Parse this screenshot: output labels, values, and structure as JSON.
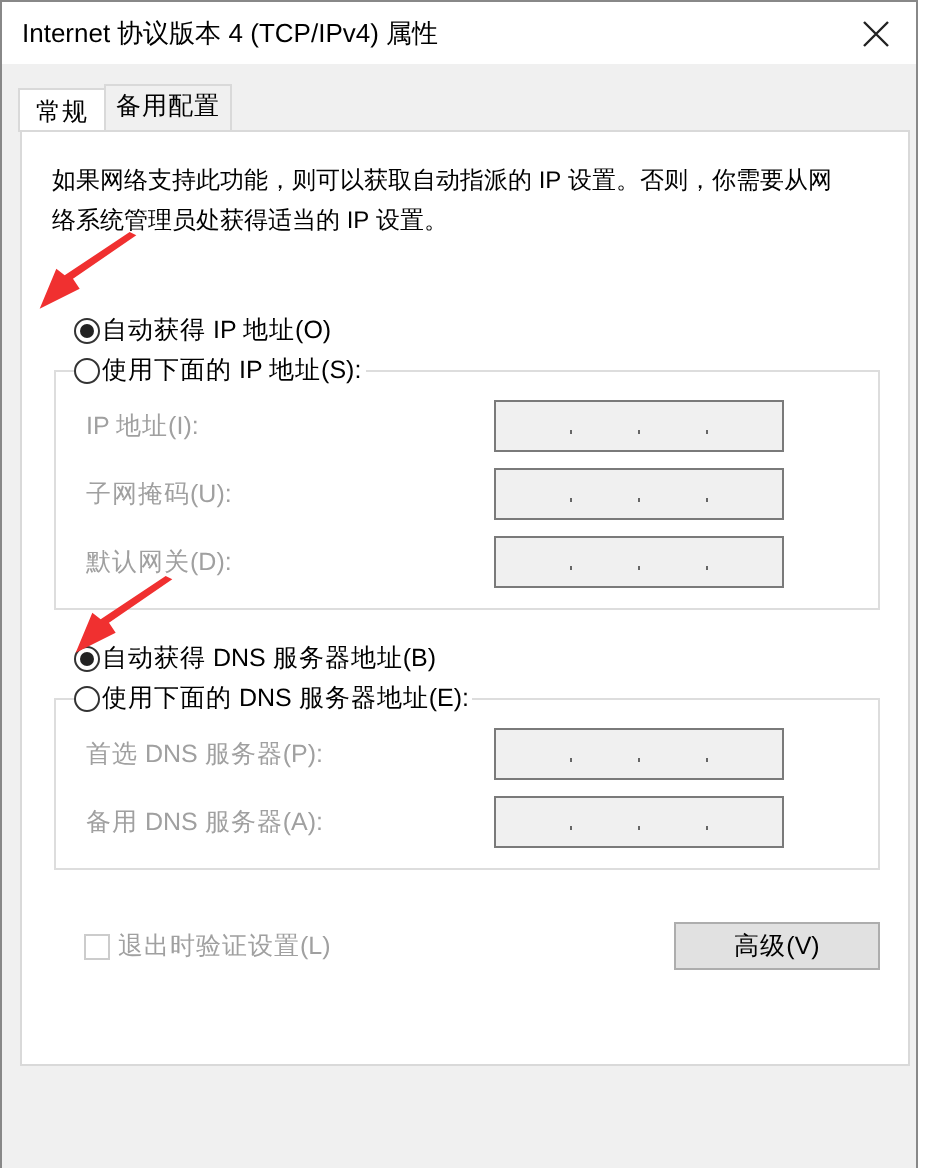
{
  "window": {
    "title": "Internet 协议版本 4 (TCP/IPv4) 属性"
  },
  "tabs": [
    {
      "label": "常规",
      "selected": true
    },
    {
      "label": "备用配置",
      "selected": false
    }
  ],
  "description": "如果网络支持此功能，则可以获取自动指派的 IP 设置。否则，你需要从网络系统管理员处获得适当的 IP 设置。",
  "sections": [
    {
      "auto_option": {
        "label": "自动获得 IP 地址(O)",
        "selected": true,
        "arrow": true
      },
      "manual_option": {
        "label": "使用下面的 IP 地址(S):",
        "selected": false
      },
      "fields": [
        {
          "label": "IP 地址(I):",
          "disabled": true
        },
        {
          "label": "子网掩码(U):",
          "disabled": true
        },
        {
          "label": "默认网关(D):",
          "disabled": true
        }
      ]
    },
    {
      "auto_option": {
        "label": "自动获得 DNS 服务器地址(B)",
        "selected": true,
        "arrow": true
      },
      "manual_option": {
        "label": "使用下面的 DNS 服务器地址(E):",
        "selected": false
      },
      "fields": [
        {
          "label": "首选 DNS 服务器(P):",
          "disabled": true
        },
        {
          "label": "备用 DNS 服务器(A):",
          "disabled": true
        }
      ]
    }
  ],
  "validate_checkbox": {
    "label": "退出时验证设置(L)",
    "checked": false,
    "disabled": true
  },
  "advanced_button": {
    "label": "高级(V)"
  }
}
